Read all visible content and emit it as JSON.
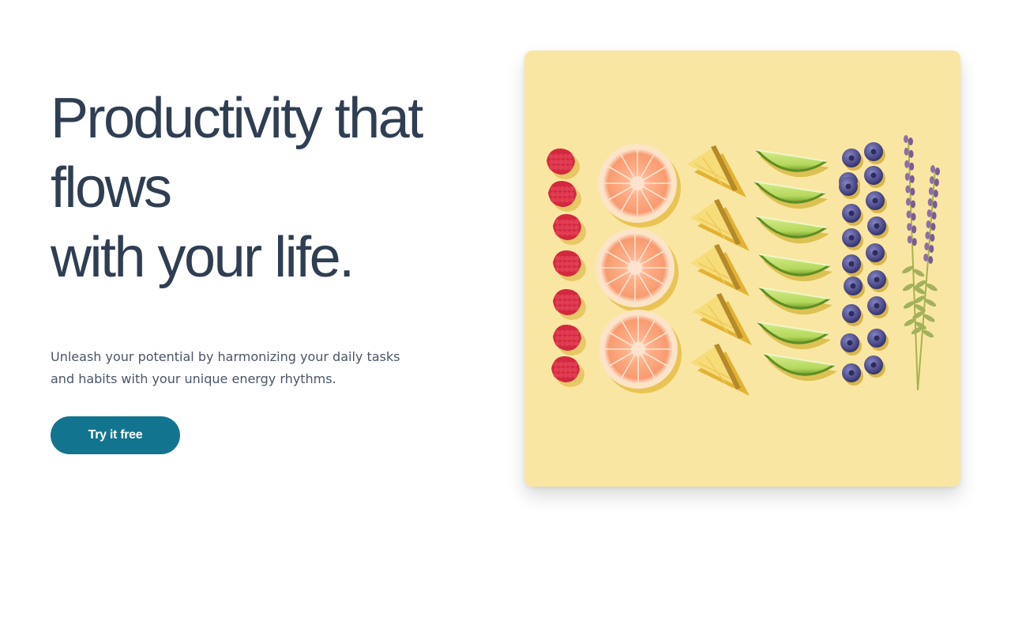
{
  "hero": {
    "headline_lines": [
      "Productivity that",
      "flows",
      "with your life."
    ],
    "subtitle_lines": [
      "Unleash your potential by harmonizing your daily tasks",
      "and habits with your unique energy rhythms."
    ],
    "cta_label": "Try it free"
  },
  "colors": {
    "headline": "#2f3e52",
    "body_text": "#4a5566",
    "cta_background": "#13748f",
    "cta_text": "#ffffff",
    "image_background": "#fae6a3"
  }
}
